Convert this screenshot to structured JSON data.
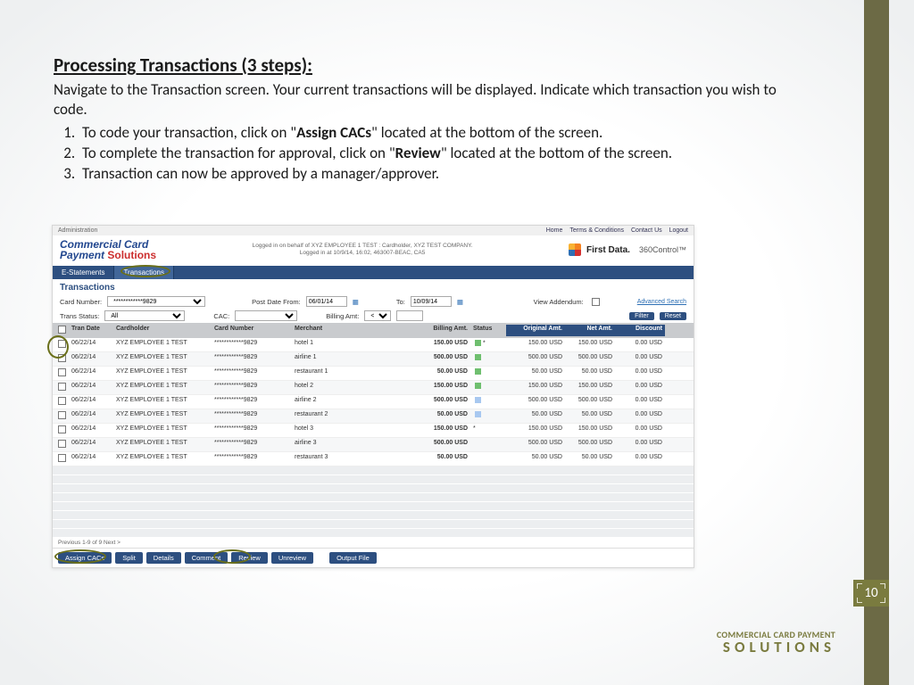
{
  "slide": {
    "heading": "Processing Transactions (3 steps):",
    "intro": "Navigate to the Transaction screen.  Your current transactions will be displayed. Indicate which transaction you wish to code.",
    "step1_pre": "To code your transaction, click on \"",
    "step1_bold": "Assign CACs",
    "step1_post": "\" located at the bottom of the screen.",
    "step2_pre": "To complete the transaction for approval, click on \"",
    "step2_bold": "Review",
    "step2_post": "\" located at the bottom of the screen.",
    "step3": "Transaction can now be approved by a manager/approver.",
    "page_num": "10",
    "footer1": "COMMERCIAL CARD PAYMENT",
    "footer2": "SOLUTIONS"
  },
  "app": {
    "admin": "Administration",
    "links": {
      "home": "Home",
      "terms": "Terms & Conditions",
      "contact": "Contact Us",
      "logout": "Logout"
    },
    "brand1": "Commercial Card",
    "brand2": "Payment ",
    "brand2b": "Solutions",
    "loggedin1": "Logged in on behalf of XYZ EMPLOYEE 1 TEST : Cardholder, XYZ TEST COMPANY.",
    "loggedin2": "Logged in at 10/9/14, 16:02, 463007-BEAC, CA5",
    "firstdata": "First Data.",
    "ctl360": "360Control™",
    "tabs": {
      "estatements": "E-Statements",
      "transactions": "Transactions"
    },
    "page_title": "Transactions",
    "filters": {
      "card_lbl": "Card Number:",
      "card_val": "************9829",
      "postfrom_lbl": "Post Date From:",
      "postfrom_val": "06/01/14",
      "to_lbl": "To:",
      "to_val": "10/09/14",
      "addendum_lbl": "View Addendum:",
      "adv": "Advanced Search",
      "status_lbl": "Trans Status:",
      "status_val": "All",
      "cac_lbl": "CAC:",
      "billing_lbl": "Billing Amt:",
      "billing_op": "<",
      "filter_btn": "Filter",
      "reset_btn": "Reset"
    },
    "cols": {
      "chk": "",
      "tran": "Tran Date",
      "holder": "Cardholder",
      "card": "Card Number",
      "merch": "Merchant",
      "amt": "Billing Amt.",
      "status": "Status",
      "orig": "Original Amt.",
      "net": "Net Amt.",
      "disc": "Discount"
    },
    "rows": [
      {
        "d": "06/22/14",
        "h": "XYZ EMPLOYEE 1 TEST",
        "c": "************9829",
        "m": "hotel 1",
        "a": "150.00 USD",
        "s": "g",
        "q": "*",
        "o": "150.00 USD",
        "n": "150.00 USD",
        "di": "0.00 USD"
      },
      {
        "d": "06/22/14",
        "h": "XYZ EMPLOYEE 1 TEST",
        "c": "************9829",
        "m": "airline 1",
        "a": "500.00 USD",
        "s": "g",
        "q": "",
        "o": "500.00 USD",
        "n": "500.00 USD",
        "di": "0.00 USD"
      },
      {
        "d": "06/22/14",
        "h": "XYZ EMPLOYEE 1 TEST",
        "c": "************9829",
        "m": "restaurant 1",
        "a": "50.00 USD",
        "s": "g",
        "q": "",
        "o": "50.00 USD",
        "n": "50.00 USD",
        "di": "0.00 USD"
      },
      {
        "d": "06/22/14",
        "h": "XYZ EMPLOYEE 1 TEST",
        "c": "************9829",
        "m": "hotel 2",
        "a": "150.00 USD",
        "s": "g",
        "q": "",
        "o": "150.00 USD",
        "n": "150.00 USD",
        "di": "0.00 USD"
      },
      {
        "d": "06/22/14",
        "h": "XYZ EMPLOYEE 1 TEST",
        "c": "************9829",
        "m": "airline 2",
        "a": "500.00 USD",
        "s": "b",
        "q": "",
        "o": "500.00 USD",
        "n": "500.00 USD",
        "di": "0.00 USD"
      },
      {
        "d": "06/22/14",
        "h": "XYZ EMPLOYEE 1 TEST",
        "c": "************9829",
        "m": "restaurant 2",
        "a": "50.00 USD",
        "s": "b",
        "q": "",
        "o": "50.00 USD",
        "n": "50.00 USD",
        "di": "0.00 USD"
      },
      {
        "d": "06/22/14",
        "h": "XYZ EMPLOYEE 1 TEST",
        "c": "************9829",
        "m": "hotel 3",
        "a": "150.00 USD",
        "s": "",
        "q": "*",
        "o": "150.00 USD",
        "n": "150.00 USD",
        "di": "0.00 USD"
      },
      {
        "d": "06/22/14",
        "h": "XYZ EMPLOYEE 1 TEST",
        "c": "************9829",
        "m": "airline 3",
        "a": "500.00 USD",
        "s": "",
        "q": "",
        "o": "500.00 USD",
        "n": "500.00 USD",
        "di": "0.00 USD"
      },
      {
        "d": "06/22/14",
        "h": "XYZ EMPLOYEE 1 TEST",
        "c": "************9829",
        "m": "restaurant 3",
        "a": "50.00 USD",
        "s": "",
        "q": "",
        "o": "50.00 USD",
        "n": "50.00 USD",
        "di": "0.00 USD"
      }
    ],
    "pager": "Previous 1-9 of 9 Next >",
    "actions": {
      "assign": "Assign CACs",
      "split": "Split",
      "details": "Details",
      "comment": "Comment",
      "review": "Review",
      "unreview": "Unreview",
      "output": "Output File"
    }
  }
}
